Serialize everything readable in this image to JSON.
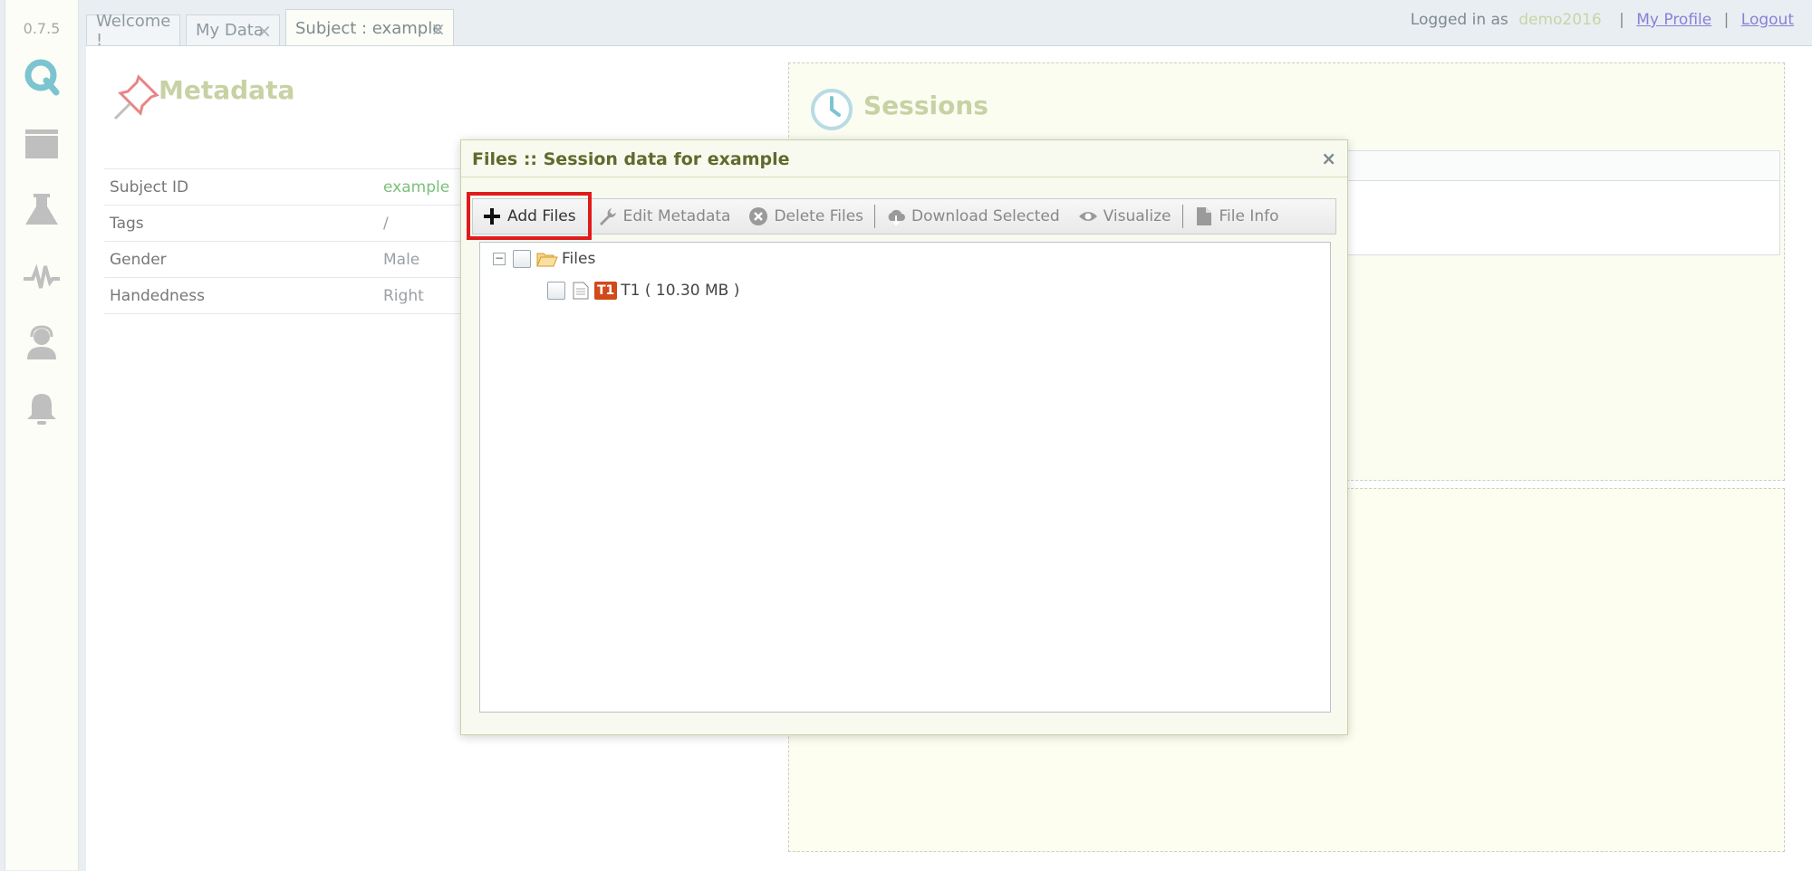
{
  "app": {
    "version": "0.7.5"
  },
  "tabs": [
    {
      "label": "Welcome !",
      "closable": false
    },
    {
      "label": "My Data",
      "closable": true
    },
    {
      "label": "Subject : example",
      "closable": true,
      "active": true
    }
  ],
  "userbar": {
    "prefix": "Logged in as",
    "username": "demo2016",
    "profile": "My Profile",
    "logout": "Logout",
    "sep": "|"
  },
  "nav_icons": [
    "q-logo-icon",
    "folder-icon",
    "flask-icon",
    "pulse-icon",
    "user-support-icon",
    "bell-icon"
  ],
  "metadata": {
    "title": "Metadata",
    "rows": [
      {
        "key": "Subject ID",
        "value": "example"
      },
      {
        "key": "Tags",
        "value": "/"
      },
      {
        "key": "Gender",
        "value": "Male"
      },
      {
        "key": "Handedness",
        "value": "Right"
      }
    ]
  },
  "sessions": {
    "title": "Sessions"
  },
  "modal": {
    "title": "Files :: Session data for example",
    "close": "×",
    "toolbar": {
      "add": "Add Files",
      "edit": "Edit Metadata",
      "delete": "Delete Files",
      "download": "Download Selected",
      "visualize": "Visualize",
      "info": "File Info"
    },
    "tree": {
      "root": "Files",
      "files": [
        {
          "badge": "T1",
          "label": "T1 ( 10.30 MB )"
        }
      ]
    }
  },
  "colors": {
    "highlight": "#e01b1b",
    "accent_green": "#c7d2a4",
    "badge": "#d14a1a"
  }
}
